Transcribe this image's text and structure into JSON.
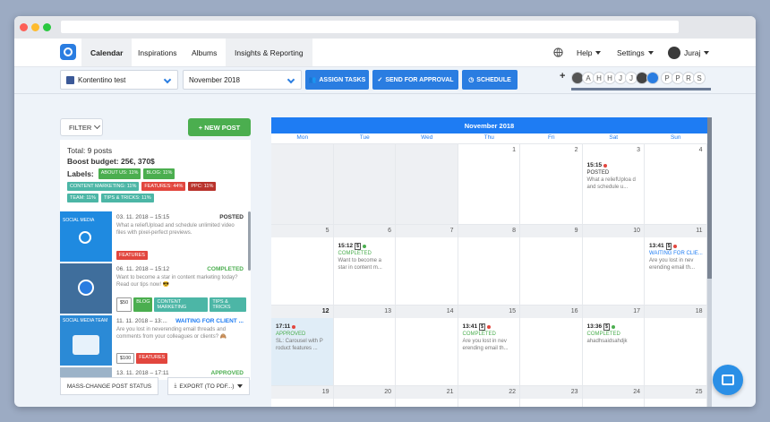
{
  "nav": {
    "tabs": [
      "Calendar",
      "Inspirations",
      "Albums",
      "Insights & Reporting"
    ],
    "help": "Help",
    "settings": "Settings",
    "user": "Juraj"
  },
  "toolbar": {
    "page_select": "Kontentino test",
    "month_select": "November 2018",
    "assign_tasks": "ASSIGN TASKS",
    "send_approval": "SEND FOR APPROVAL",
    "schedule": "SCHEDULE",
    "plus": "+",
    "avatars": [
      "A",
      "H",
      "H",
      "J",
      "J",
      "P",
      "P",
      "R",
      "S"
    ]
  },
  "sidebar": {
    "filter": "FILTER",
    "new_post": "+ NEW POST",
    "total": "Total: 9 posts",
    "boost": "Boost budget: 25€, 370$",
    "labels_title": "Labels:",
    "labels": [
      {
        "text": "ABOUT US: 11%",
        "color": "#4bae4f"
      },
      {
        "text": "BLOG: 11%",
        "color": "#4bae4f"
      },
      {
        "text": "CONTENT MARKETING: 11%",
        "color": "#4cb6a6"
      },
      {
        "text": "FEATURES: 44%",
        "color": "#e2463e"
      },
      {
        "text": "PPC: 11%",
        "color": "#b9322b"
      },
      {
        "text": "TEAM: 11%",
        "color": "#4cb6a6"
      },
      {
        "text": "TIPS & TRICKS: 11%",
        "color": "#4cb6a6"
      }
    ],
    "posts": [
      {
        "date": "03. 11. 2018 – 15:15",
        "status": "POSTED",
        "status_color": "#333",
        "text": "What a reliefUpload and schedule unlimited video files with pixel-perfect previews.",
        "tags": [
          {
            "text": "FEATURES",
            "color": "#e2463e"
          }
        ],
        "thumb_label": "SOCIAL MEDIA"
      },
      {
        "date": "06. 11. 2018 – 15:12",
        "status": "COMPLETED",
        "status_color": "#4bae4f",
        "text": "Want to become a star in content marketing today? Read our tips now! 😎",
        "tags": [
          {
            "text": "$50",
            "color": "#fff"
          },
          {
            "text": "BLOG",
            "color": "#4bae4f"
          },
          {
            "text": "CONTENT MARKETING",
            "color": "#4cb6a6"
          },
          {
            "text": "TIPS & TRICKS",
            "color": "#4cb6a6"
          }
        ],
        "thumb_label": ""
      },
      {
        "date": "11. 11. 2018 – 13:...",
        "status": "WAITING FOR CLIENT ...",
        "status_color": "#1e7cf3",
        "text": "Are you lost in neverending email threads and comments from your colleagues or clients? 🙈",
        "tags": [
          {
            "text": "$100",
            "color": "#fff"
          },
          {
            "text": "FEATURES",
            "color": "#e2463e"
          }
        ],
        "thumb_label": "SOCIAL MEDIA TEAM"
      },
      {
        "date": "13. 11. 2018 – 17:11",
        "status": "APPROVED",
        "status_color": "#4bae4f",
        "text": "",
        "tags": [],
        "thumb_label": ""
      }
    ],
    "mass_change": "MASS-CHANGE POST STATUS",
    "export": "EXPORT (TO PDF...)"
  },
  "calendar": {
    "month": "November 2018",
    "days": [
      "Mon",
      "Tue",
      "Wed",
      "Thu",
      "Fri",
      "Sat",
      "Sun"
    ],
    "weeks": [
      [
        {
          "n": "",
          "g": true
        },
        {
          "n": "",
          "g": true
        },
        {
          "n": "",
          "g": true
        },
        {
          "n": "1"
        },
        {
          "n": "2"
        },
        {
          "n": "3"
        },
        {
          "n": "4"
        }
      ],
      [
        {
          "n": "5"
        },
        {
          "n": "6"
        },
        {
          "n": "7"
        },
        {
          "n": "8"
        },
        {
          "n": "9"
        },
        {
          "n": "10"
        },
        {
          "n": "11"
        }
      ],
      [
        {
          "n": "12",
          "today": true
        },
        {
          "n": "13"
        },
        {
          "n": "14"
        },
        {
          "n": "15"
        },
        {
          "n": "16"
        },
        {
          "n": "17"
        },
        {
          "n": "18"
        }
      ],
      [
        {
          "n": "19"
        },
        {
          "n": "20"
        },
        {
          "n": "21"
        },
        {
          "n": "22"
        },
        {
          "n": "23"
        },
        {
          "n": "24"
        },
        {
          "n": "25"
        }
      ]
    ],
    "events": [
      {
        "week": 0,
        "day": 5,
        "time": "15:15",
        "money": false,
        "dot": "#e2463e",
        "status": "POSTED",
        "status_color": "#333",
        "text": "What a reliefUploa d and schedule u..."
      },
      {
        "week": 1,
        "day": 1,
        "time": "15:12",
        "money": true,
        "dot": "#4bae4f",
        "status": "COMPLETED",
        "status_color": "#4bae4f",
        "text": "Want to become a star in content m..."
      },
      {
        "week": 1,
        "day": 6,
        "time": "13:41",
        "money": true,
        "dot": "#e2463e",
        "status": "WAITING FOR CLIE...",
        "status_color": "#1e7cf3",
        "text": "Are you lost in nev erending email th..."
      },
      {
        "week": 2,
        "day": 0,
        "time": "17:11",
        "money": false,
        "dot": "#e2463e",
        "status": "APPROVED",
        "status_color": "#4bae4f",
        "text": "SL: Carousel with P roduct features ..."
      },
      {
        "week": 2,
        "day": 3,
        "time": "13:41",
        "money": true,
        "dot": "#e2463e",
        "status": "COMPLETED",
        "status_color": "#4bae4f",
        "text": "Are you lost in nev erending email th..."
      },
      {
        "week": 2,
        "day": 5,
        "time": "13:36",
        "money": true,
        "dot": "#4bae4f",
        "status": "COMPLETED",
        "status_color": "#4bae4f",
        "text": "ahadhsaidsahdjk"
      }
    ]
  }
}
